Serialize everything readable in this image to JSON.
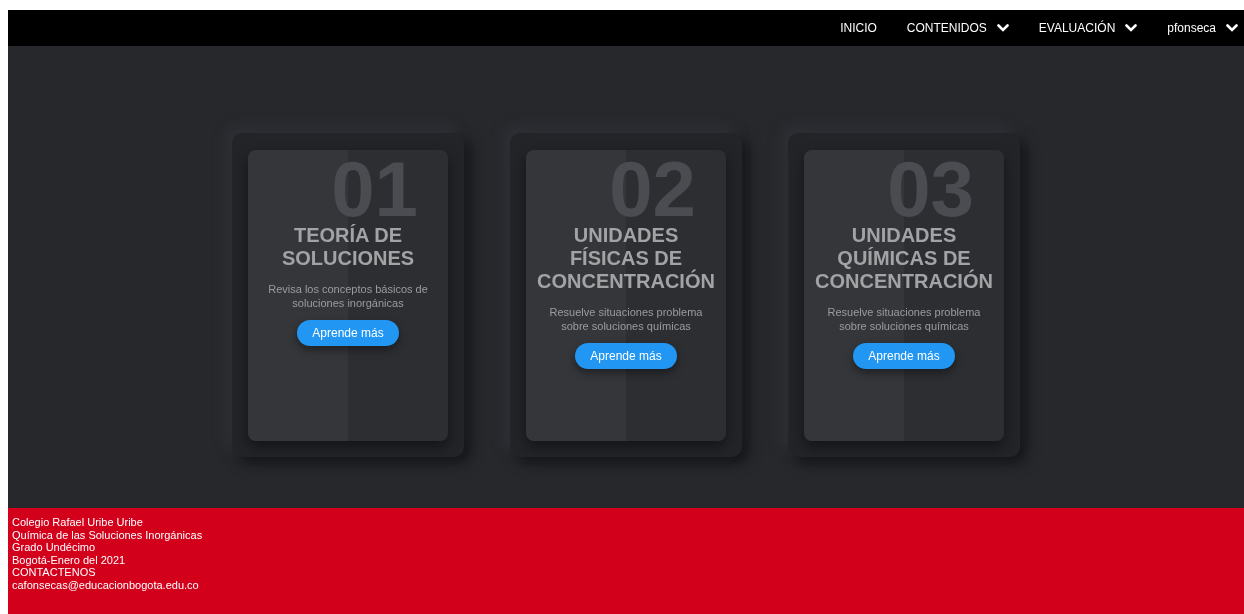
{
  "nav": [
    {
      "label": "INICIO",
      "kind": "link"
    },
    {
      "label": "CONTENIDOS",
      "kind": "dropdown"
    },
    {
      "label": "EVALUACIÓN",
      "kind": "dropdown"
    },
    {
      "label": "pfonseca",
      "kind": "dropdown"
    }
  ],
  "cards": [
    {
      "number": "01",
      "title": "TEORÍA DE SOLUCIONES",
      "text": "Revisa los conceptos básicos de soluciones inorgánicas",
      "button": "Aprende más"
    },
    {
      "number": "02",
      "title": "UNIDADES FÍSICAS DE CONCENTRACIÓN",
      "text": "Resuelve situaciones problema sobre soluciones químicas",
      "button": "Aprende más"
    },
    {
      "number": "03",
      "title": "UNIDADES QUÍMICAS DE CONCENTRACIÓN",
      "text": "Resuelve situaciones problema sobre soluciones químicas",
      "button": "Aprende más"
    }
  ],
  "footer": {
    "lines": [
      "Colegio Rafael Uribe Uribe",
      "Química de las Soluciones Inorgánicas",
      "Grado Undécimo",
      "Bogotá-Enero del 2021",
      "CONTACTENOS"
    ],
    "email": "cafonsecas@educacionbogota.edu.co"
  }
}
